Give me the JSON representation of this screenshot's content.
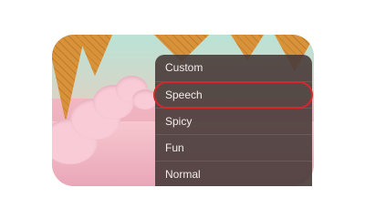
{
  "menu": {
    "items": [
      {
        "label": "Custom"
      },
      {
        "label": "Speech"
      },
      {
        "label": "Spicy"
      },
      {
        "label": "Fun"
      },
      {
        "label": "Normal"
      }
    ],
    "selected_label": "Speech",
    "highlight_color": "#d8262b"
  },
  "background": {
    "description_icon": "ice-cream-cone-scene"
  }
}
